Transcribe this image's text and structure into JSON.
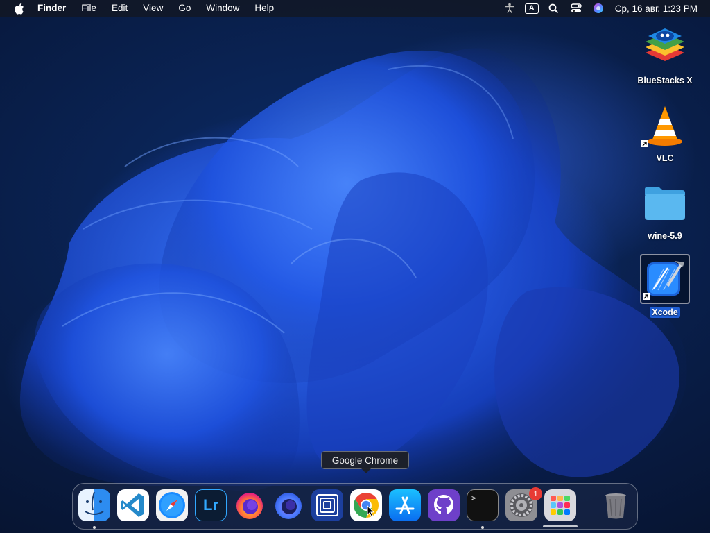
{
  "menubar": {
    "app_name": "Finder",
    "menus": [
      "File",
      "Edit",
      "View",
      "Go",
      "Window",
      "Help"
    ],
    "clock": "Ср, 16 авг.  1:23 PM",
    "status_icons": [
      "accessibility-icon",
      "input-source-icon",
      "spotlight-icon",
      "control-center-icon",
      "siri-icon"
    ],
    "input_source_letter": "A"
  },
  "desktop": {
    "icons": [
      {
        "label": "BlueStacks X",
        "name": "bluestacks-x"
      },
      {
        "label": "VLC",
        "name": "vlc"
      },
      {
        "label": "wine-5.9",
        "name": "wine-5-9-folder"
      },
      {
        "label": "Xcode",
        "name": "xcode",
        "selected": true
      }
    ]
  },
  "tooltip": "Google Chrome",
  "dock": {
    "apps": [
      {
        "name": "finder",
        "running": true
      },
      {
        "name": "vscode"
      },
      {
        "name": "safari"
      },
      {
        "name": "lightroom",
        "text": "Lr"
      },
      {
        "name": "firefox"
      },
      {
        "name": "firefox-developer-edition"
      },
      {
        "name": "frames-app"
      },
      {
        "name": "google-chrome"
      },
      {
        "name": "app-store"
      },
      {
        "name": "github-desktop"
      },
      {
        "name": "terminal",
        "text": ">_",
        "running": true
      },
      {
        "name": "system-preferences",
        "badge": "1"
      },
      {
        "name": "launchpad"
      },
      {
        "name": "trash"
      }
    ]
  },
  "colors": {
    "accent": "#1f5fd6",
    "badge": "#e83a34",
    "wallpaper_bloom": "#2f6cff"
  }
}
